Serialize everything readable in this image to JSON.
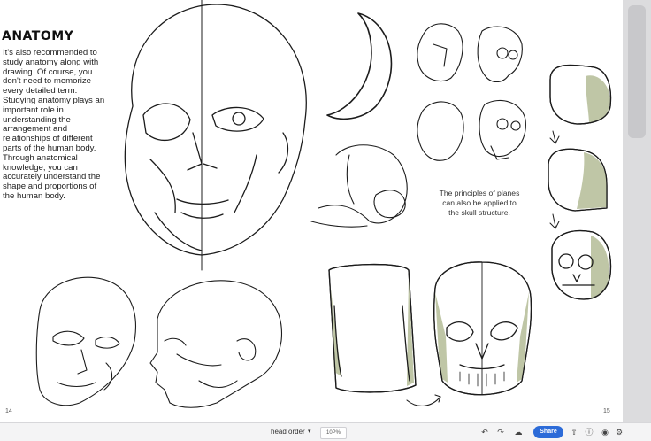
{
  "page": {
    "heading": "ANATOMY",
    "body": "It's also recommended to study anatomy along with drawing. Of course, you don't need to memorize every detailed term. Studying anatomy plays an important role in understanding the arrangement and relationships of different parts of the human body. Through anatomical knowledge, you can accurately understand the shape and proportions of the human body.",
    "caption": "The principles of planes can also be applied to the skull structure.",
    "page_left": "14",
    "page_right": "15"
  },
  "toolbar": {
    "document_title": "head order",
    "zoom": "10P%",
    "share_label": "Share",
    "icons": [
      "dropdown-chevron-icon",
      "undo-icon",
      "redo-icon",
      "cloud-sync-icon",
      "share-button",
      "export-icon",
      "help-icon",
      "settings-icon"
    ]
  },
  "colors": {
    "page_bg": "#ffffff",
    "shade": "#bfc6a6",
    "share": "#2c6bd8",
    "ink": "#1c1c1c"
  }
}
